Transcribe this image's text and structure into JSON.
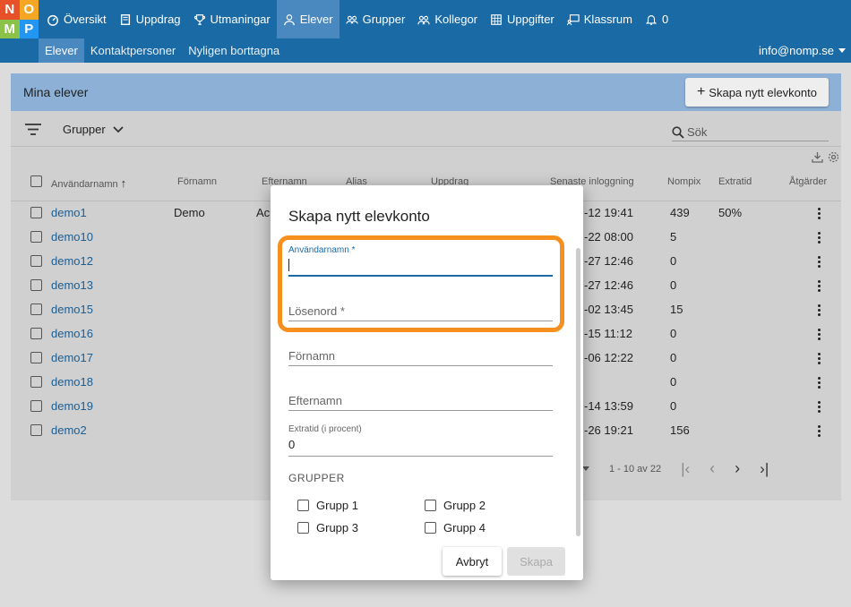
{
  "logo": {
    "letters": [
      "N",
      "O",
      "M",
      "P"
    ],
    "colors": [
      "#e8502a",
      "#f5a623",
      "#8bc34a",
      "#2196f3"
    ]
  },
  "nav": {
    "items": [
      {
        "label": "Översikt",
        "icon": "dashboard-icon"
      },
      {
        "label": "Uppdrag",
        "icon": "book-icon"
      },
      {
        "label": "Utmaningar",
        "icon": "trophy-icon"
      },
      {
        "label": "Elever",
        "icon": "user-icon",
        "active": true
      },
      {
        "label": "Grupper",
        "icon": "group-icon"
      },
      {
        "label": "Kollegor",
        "icon": "colleagues-icon"
      },
      {
        "label": "Uppgifter",
        "icon": "grid-icon"
      },
      {
        "label": "Klassrum",
        "icon": "classroom-icon"
      },
      {
        "label": "0",
        "icon": "bell-icon"
      }
    ]
  },
  "subnav": {
    "items": [
      {
        "label": "Elever",
        "active": true
      },
      {
        "label": "Kontaktpersoner"
      },
      {
        "label": "Nyligen borttagna"
      }
    ]
  },
  "user": {
    "email": "info@nomp.se"
  },
  "page": {
    "title": "Mina elever",
    "create_button": "Skapa nytt elevkonto"
  },
  "filters": {
    "groups_label": "Grupper",
    "search_placeholder": "Sök"
  },
  "table": {
    "headers": [
      "Användarnamn",
      "Förnamn",
      "Efternamn",
      "Alias",
      "Uppdrag",
      "Senaste inloggning",
      "Nompix",
      "Extratid",
      "Åtgärder"
    ],
    "rows": [
      {
        "username": "demo1",
        "first": "Demo",
        "last": "Ac",
        "login": "-12 19:41",
        "nompix": "439",
        "extra": "50%"
      },
      {
        "username": "demo10",
        "first": "",
        "last": "",
        "login": "-22 08:00",
        "nompix": "5",
        "extra": ""
      },
      {
        "username": "demo12",
        "first": "",
        "last": "",
        "login": "-27 12:46",
        "nompix": "0",
        "extra": ""
      },
      {
        "username": "demo13",
        "first": "",
        "last": "",
        "login": "-27 12:46",
        "nompix": "0",
        "extra": ""
      },
      {
        "username": "demo15",
        "first": "",
        "last": "",
        "login": "-02 13:45",
        "nompix": "15",
        "extra": ""
      },
      {
        "username": "demo16",
        "first": "",
        "last": "",
        "login": "-15 11:12",
        "nompix": "0",
        "extra": ""
      },
      {
        "username": "demo17",
        "first": "",
        "last": "",
        "login": "-06 12:22",
        "nompix": "0",
        "extra": ""
      },
      {
        "username": "demo18",
        "first": "",
        "last": "",
        "login": "",
        "nompix": "0",
        "extra": ""
      },
      {
        "username": "demo19",
        "first": "",
        "last": "",
        "login": "-14 13:59",
        "nompix": "0",
        "extra": ""
      },
      {
        "username": "demo2",
        "first": "",
        "last": "",
        "login": "-26 19:21",
        "nompix": "156",
        "extra": ""
      }
    ]
  },
  "pagination": {
    "range": "1 - 10 av 22"
  },
  "modal": {
    "title": "Skapa nytt elevkonto",
    "username_label": "Användarnamn *",
    "password_label": "Lösenord *",
    "firstname_label": "Förnamn",
    "lastname_label": "Efternamn",
    "extratime_label": "Extratid (i procent)",
    "extratime_value": "0",
    "groups_heading": "GRUPPER",
    "groups": [
      "Grupp 1",
      "Grupp 2",
      "Grupp 3",
      "Grupp 4"
    ],
    "cancel": "Avbryt",
    "create": "Skapa"
  },
  "colors": {
    "primary": "#1a6aa6",
    "highlight": "#f5901e"
  }
}
